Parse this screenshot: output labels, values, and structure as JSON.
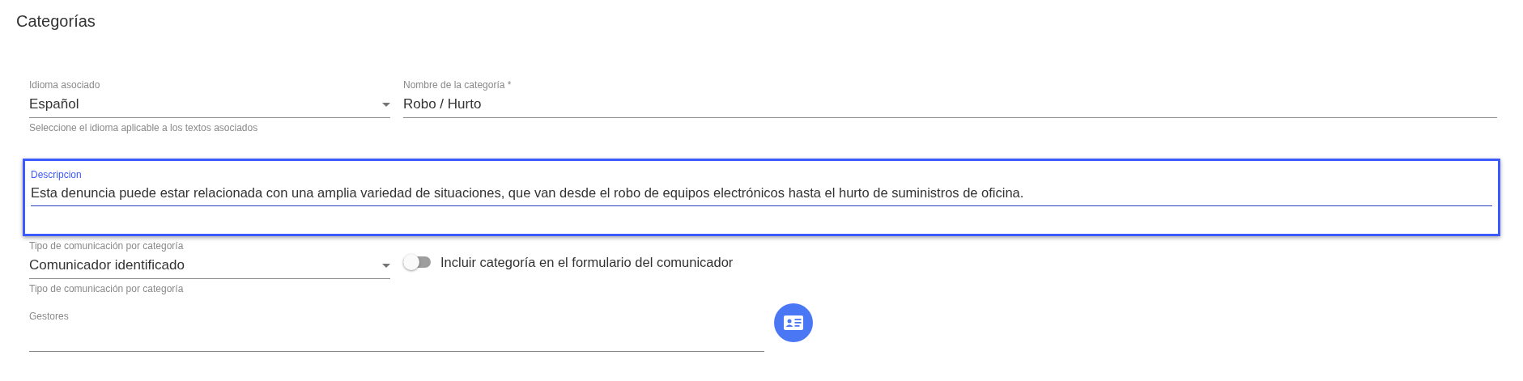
{
  "title": "Categorías",
  "language_select": {
    "label": "Idioma asociado",
    "value": "Español",
    "hint": "Seleccione el idioma aplicable a los textos asociados"
  },
  "category_name": {
    "label": "Nombre de la categoría *",
    "value": "Robo / Hurto"
  },
  "description": {
    "label": "Descripcion",
    "value": "Esta denuncia puede estar relacionada con una amplia variedad de situaciones, que van desde el robo de equipos electrónicos hasta el hurto de suministros de oficina.",
    "focused": true
  },
  "communication_select": {
    "label": "Tipo de comunicación por categoría",
    "value": "Comunicador identificado",
    "hint": "Tipo de comunicación por categoría"
  },
  "include_toggle": {
    "label": "Incluir categoría en el formulario del comunicador",
    "on": false
  },
  "managers": {
    "label": "Gestores"
  }
}
